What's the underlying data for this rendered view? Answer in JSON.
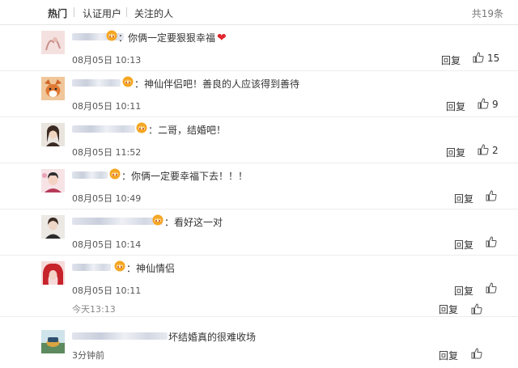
{
  "tabs": {
    "hot": "热门",
    "verified": "认证用户",
    "followed": "关注的人",
    "total": "共19条"
  },
  "comments": [
    {
      "text": "：你俩一定要狠狠幸福",
      "heart": "❤",
      "time": "08月05日 10:13",
      "reply": "回复",
      "likes": "15"
    },
    {
      "text": "：神仙伴侣吧！善良的人应该得到善待",
      "time": "08月05日 10:11",
      "reply": "回复",
      "likes": "9"
    },
    {
      "text": "：二哥，结婚吧！",
      "time": "08月05日 11:52",
      "reply": "回复",
      "likes": "2"
    },
    {
      "text": "：你俩一定要幸福下去！！！",
      "time": "08月05日 10:49",
      "reply": "回复",
      "likes": ""
    },
    {
      "text": "：看好这一对",
      "time": "08月05日 10:14",
      "reply": "回复",
      "likes": ""
    },
    {
      "text": "：神仙情侣",
      "time": "08月05日 10:11",
      "reply": "回复",
      "likes": ""
    }
  ],
  "overlap": {
    "time": "今天13:13",
    "reply": "回复"
  },
  "last": {
    "text": "坏结婚真的很难收场",
    "time": "3分钟前",
    "reply": "回复"
  },
  "colors": {
    "text": "#333333",
    "heart": "#e0262e",
    "divider": "#ededed",
    "badge": "#f5a623"
  },
  "icons": {
    "like": "thumbs-up-icon",
    "badge": "vip-crown-icon"
  }
}
